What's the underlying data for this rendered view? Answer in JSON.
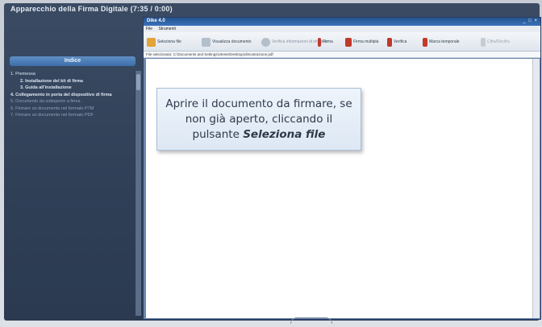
{
  "app": {
    "title": "Apparecchio della Firma Digitale   (7:35 / 0:00)"
  },
  "index": {
    "header": "Indice",
    "items": [
      {
        "label": "1. Premessa",
        "level": 0,
        "style": "normal"
      },
      {
        "label": "2. Installazione del kit di firma",
        "level": 1,
        "style": "bold"
      },
      {
        "label": "3. Guida all'installazione",
        "level": 1,
        "style": "bold"
      },
      {
        "label": "4. Collegamento in porta del dispositivo di firma",
        "level": 0,
        "style": "bold"
      },
      {
        "label": "5. Documento da sottoporre a firma",
        "level": 0,
        "style": "dim"
      },
      {
        "label": "6. Firmare un documento nel formato P7M",
        "level": 0,
        "style": "dim"
      },
      {
        "label": "7. Firmare un documento nel formato PDF",
        "level": 0,
        "style": "dim"
      }
    ]
  },
  "window": {
    "title": "Dike 4.0",
    "controls": "_ □ ×",
    "menu": [
      "File",
      "Strumenti"
    ],
    "toolbar": [
      {
        "label": "Seleziona file",
        "icon": "folder-icon",
        "color": "#e2a33a"
      },
      {
        "label": "Visualizza documento",
        "icon": "document-icon",
        "color": "#9aa8b8"
      },
      {
        "label": "Verifica informazioni di integrità",
        "icon": "refresh-icon",
        "color": "#9aa8b8"
      },
      {
        "label": "Firma",
        "icon": "pen-icon",
        "color": "#c0392b"
      },
      {
        "label": "Firma multipla",
        "icon": "pen-multiple-icon",
        "color": "#c0392b"
      },
      {
        "label": "Verifica",
        "icon": "check-icon",
        "color": "#c0392b"
      },
      {
        "label": "Marca temporale",
        "icon": "timestamp-icon",
        "color": "#c0392b"
      },
      {
        "label": "Cifra/Decifra",
        "icon": "lock-icon",
        "color": "#9aa8b8"
      }
    ],
    "path": "File selezionato: C:\\Documents and Settings\\Utente\\Desktop\\dimostrazione.pdf"
  },
  "callout": {
    "text": "Aprire il documento da firmare, se non già aperto, cliccando il pulsante",
    "emphasis": "Seleziona file"
  }
}
